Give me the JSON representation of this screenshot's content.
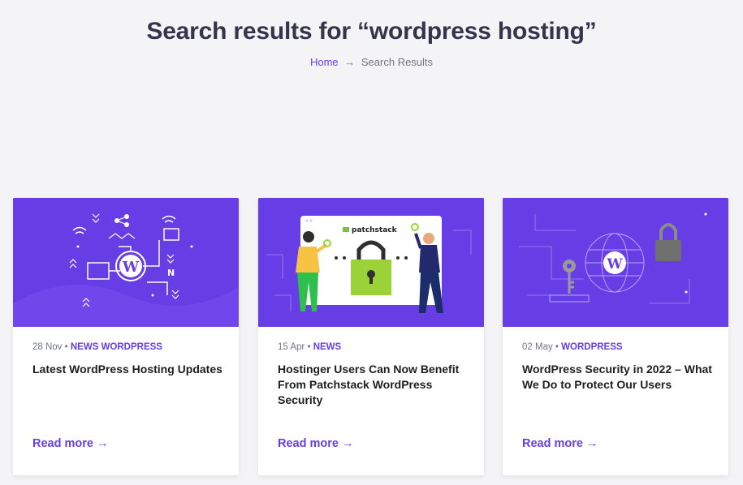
{
  "page": {
    "title": "Search results for “wordpress hosting”"
  },
  "breadcrumb": {
    "home": "Home",
    "separator": "→",
    "current": "Search Results"
  },
  "colors": {
    "accent": "#673de6",
    "background": "#f4f4f6",
    "title": "#36344d"
  },
  "cards": [
    {
      "date": "28 Nov",
      "bullet": "•",
      "category": "NEWS WORDPRESS",
      "title": "Latest WordPress Hosting Updates",
      "read_more": "Read more",
      "arrow": "→",
      "image": "wordpress-network-illustration"
    },
    {
      "date": "15 Apr",
      "bullet": "•",
      "category": "NEWS",
      "title": "Hostinger Users Can Now Benefit From Patchstack WordPress Security",
      "read_more": "Read more",
      "arrow": "→",
      "image": "patchstack-padlock-illustration",
      "image_text": "patchstack"
    },
    {
      "date": "02 May",
      "bullet": "•",
      "category": "WORDPRESS",
      "title": "WordPress Security in 2022 – What We Do to Protect Our Users",
      "read_more": "Read more",
      "arrow": "→",
      "image": "wordpress-globe-lock-illustration"
    }
  ]
}
